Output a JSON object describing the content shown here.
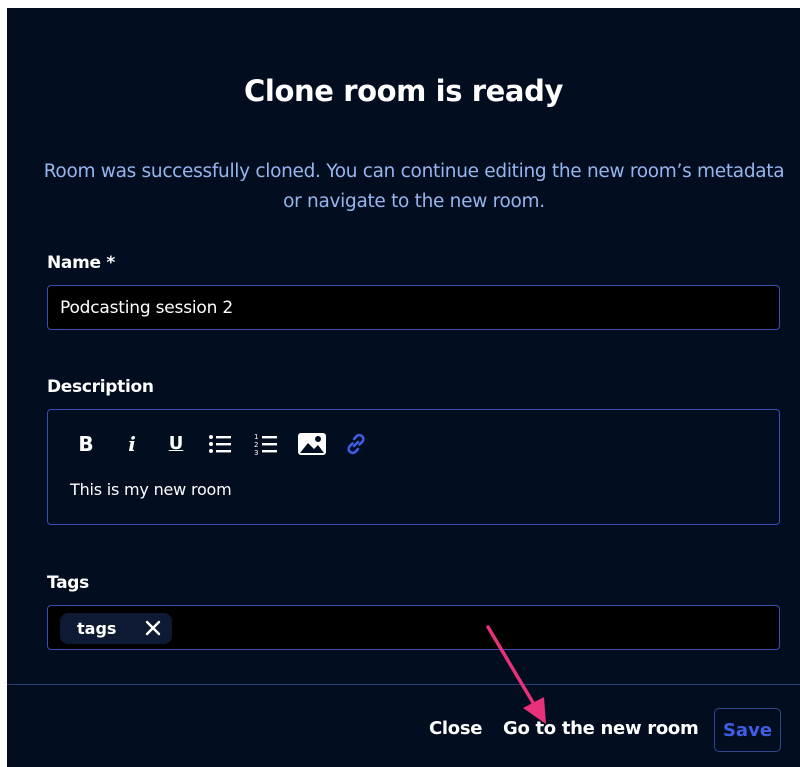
{
  "dialog": {
    "title": "Clone room is ready",
    "message": "Room was successfully cloned. You can continue editing the new room’s metadata or navigate to the new room."
  },
  "form": {
    "name": {
      "label": "Name *",
      "value": "Podcasting session 2"
    },
    "description": {
      "label": "Description",
      "value": "This is my new room",
      "toolbar": [
        {
          "icon": "bold-icon",
          "glyph": "B"
        },
        {
          "icon": "italic-icon",
          "glyph": "i"
        },
        {
          "icon": "underline-icon",
          "glyph": "U"
        },
        {
          "icon": "bulleted-list-icon"
        },
        {
          "icon": "numbered-list-icon"
        },
        {
          "icon": "image-icon"
        },
        {
          "icon": "link-icon"
        }
      ]
    },
    "tags": {
      "label": "Tags",
      "items": [
        {
          "label": "tags"
        }
      ]
    }
  },
  "footer": {
    "close_label": "Close",
    "go_label": "Go to the new room",
    "save_label": "Save"
  },
  "colors": {
    "background": "#020d20",
    "message": "#97b6ee",
    "border": "#3a4fb5",
    "save_text": "#3f5ee6",
    "link_icon": "#3f5ee6",
    "annotation_arrow": "#e7317a"
  }
}
